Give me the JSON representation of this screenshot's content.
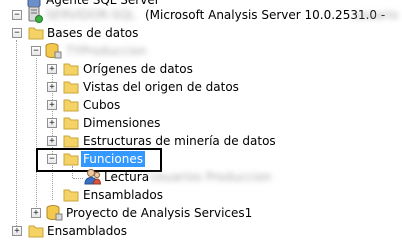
{
  "colors": {
    "folder": "#f5d266",
    "folder_edge": "#c9a43a",
    "selection": "#3399ff",
    "expander_border": "#919191"
  },
  "tree": {
    "top_node_label": "Agente SQL Server",
    "server_name_obscured": "SERVIDOR-SQL",
    "server_version": "(Microsoft Analysis Server 10.0.2531.0 -",
    "server_user_obscured": "usuario",
    "bases_de_datos": "Bases de datos",
    "database_obscured": "TYProduccion",
    "origenes": "Orígenes de datos",
    "vistas": "Vistas del origen de datos",
    "cubos": "Cubos",
    "dimensiones": "Dimensiones",
    "estructuras": "Estructuras de minería de datos",
    "funciones": "Funciones",
    "lectura": "Lectura",
    "lectura_member_obscured": "Usuarios Produccion",
    "ensamblados_db": "Ensamblados",
    "proyecto": "Proyecto de Analysis Services1",
    "ensamblados_server": "Ensamblados"
  },
  "expanders": {
    "collapse": "−",
    "expand": "+"
  },
  "icons": {
    "folder": "folder-icon",
    "server": "server-icon",
    "database": "database-icon",
    "role": "role-icon",
    "project": "project-icon",
    "agent": "agent-icon"
  }
}
